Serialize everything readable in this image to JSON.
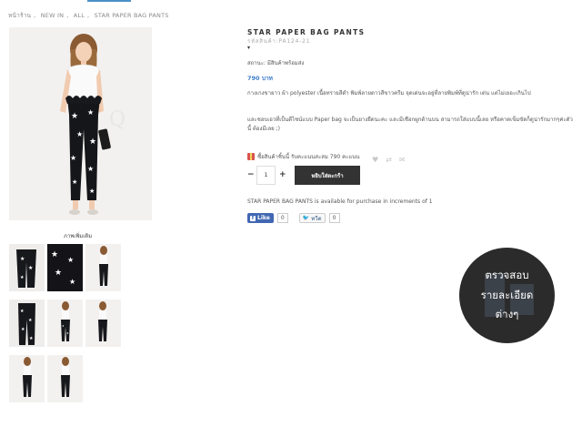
{
  "breadcrumb": {
    "items": [
      "หน้าร้าน",
      "NEW IN",
      "ALL",
      "STAR PAPER BAG PANTS"
    ],
    "separator": ","
  },
  "product": {
    "title": "STAR PAPER BAG PANTS",
    "sku": "รหัสสินค้า:PA124-21",
    "caret": "▾",
    "status": "สถานะ: มีสินค้าพร้อมส่ง",
    "price": "790 บาท",
    "description_1": "กางเกงขายาว ผ้า polyester เนื้อทรายสีดำ พิมพ์ลายดาวสีขาวครีม  จุดเด่นจะอยู่ที่ลายพิมพ์ที่ดูน่ารัก เด่น แต่ไม่เยอะเกินไป",
    "description_2": "และชอบเอวที่เป็นดีไซน์แบบ Paper bag จะเป็นยางยืดนะคะ และมีเชือกผูกด้านบน สามารถใส่แบบนี้เลย หรือคาดเข็มขัดก็ดูน่ารักมากๆค่ะตัวนี้ ต้องมีเลย ;)",
    "points": "ซื้อสินค้าชิ้นนี้ รับคะแนนสะสม 790 คะแนน",
    "quantity": "1",
    "qty_minus": "−",
    "qty_plus": "+",
    "add_to_cart_label": "หยิบใส่ตะกร้า",
    "increments_note": "STAR PAPER BAG PANTS is available for purchase in increments of 1"
  },
  "gallery": {
    "more_images_label": "ภาพเพิ่มเติม"
  },
  "social": {
    "fb_label": "Like",
    "fb_count": "0",
    "tw_label": "ทวีต",
    "tw_count": "0"
  },
  "floating_badge": {
    "line1": "ตรวจสอบ",
    "line2": "รายละเอียด",
    "line3": "ต่างๆ"
  },
  "icons": [
    "heart-icon",
    "compare-icon",
    "email-icon",
    "gift-icon",
    "facebook-icon",
    "twitter-icon"
  ],
  "colors": {
    "accent": "#4a90c8",
    "price": "#3d7cc9",
    "button": "#333333",
    "facebook": "#4267b2",
    "badge": "#2b2b2b"
  }
}
